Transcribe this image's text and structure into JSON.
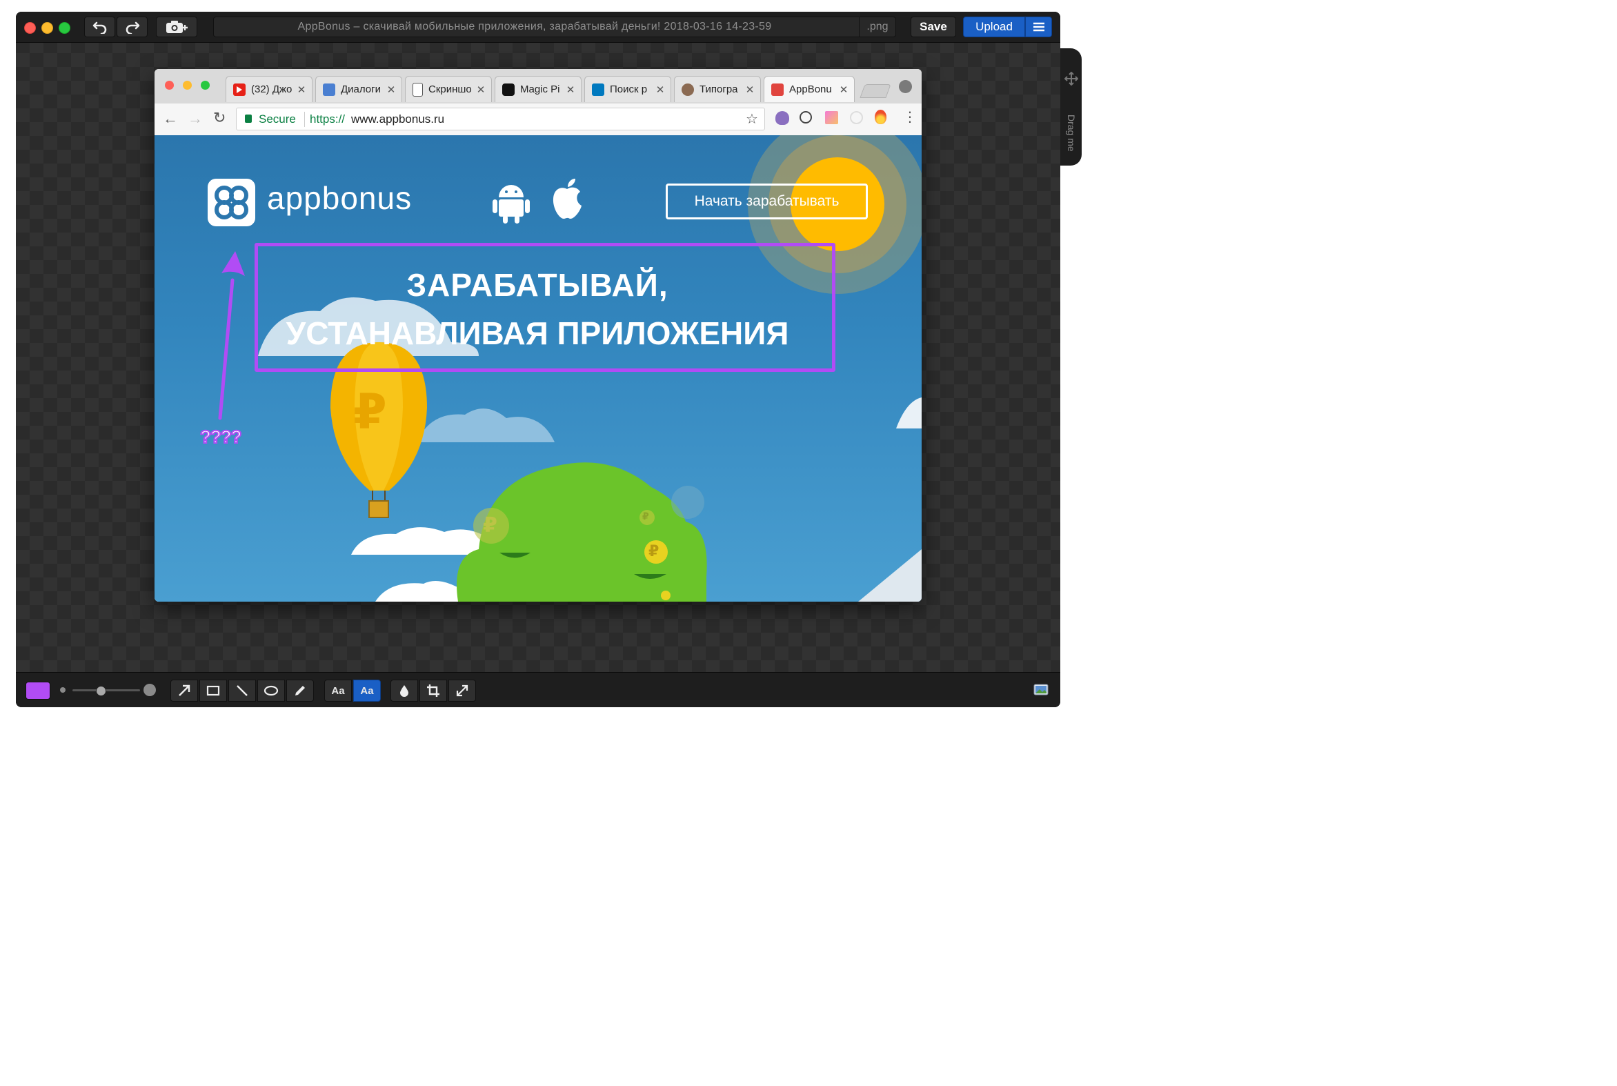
{
  "editor": {
    "title": "AppBonus – скачивай мобильные приложения, зарабатывай деньги! 2018-03-16 14-23-59",
    "extension": ".png",
    "save_label": "Save",
    "upload_label": "Upload",
    "drag_label": "Drag me",
    "accent_color": "#b14cf5"
  },
  "browser": {
    "tabs": [
      {
        "title": "(32) Джо",
        "icon": "youtube-icon"
      },
      {
        "title": "Диалоги",
        "icon": "chat-icon"
      },
      {
        "title": "Скриншо",
        "icon": "document-icon"
      },
      {
        "title": "Magic Pi",
        "icon": "camera-icon"
      },
      {
        "title": "Поиск р",
        "icon": "trello-icon"
      },
      {
        "title": "Типогра",
        "icon": "avatar-icon"
      },
      {
        "title": "AppBonu",
        "icon": "appbonus-icon"
      }
    ],
    "secure_label": "Secure",
    "url_scheme": "https://",
    "url_host": "www.appbonus.ru"
  },
  "page": {
    "logo_text": "appbonus",
    "cta_label": "Начать зарабатывать",
    "headline_line1": "ЗАРАБАТЫВАЙ,",
    "headline_line2": "УСТАНАВЛИВАЯ ПРИЛОЖЕНИЯ",
    "currency_symbol": "₽",
    "annotation_text": "????"
  }
}
